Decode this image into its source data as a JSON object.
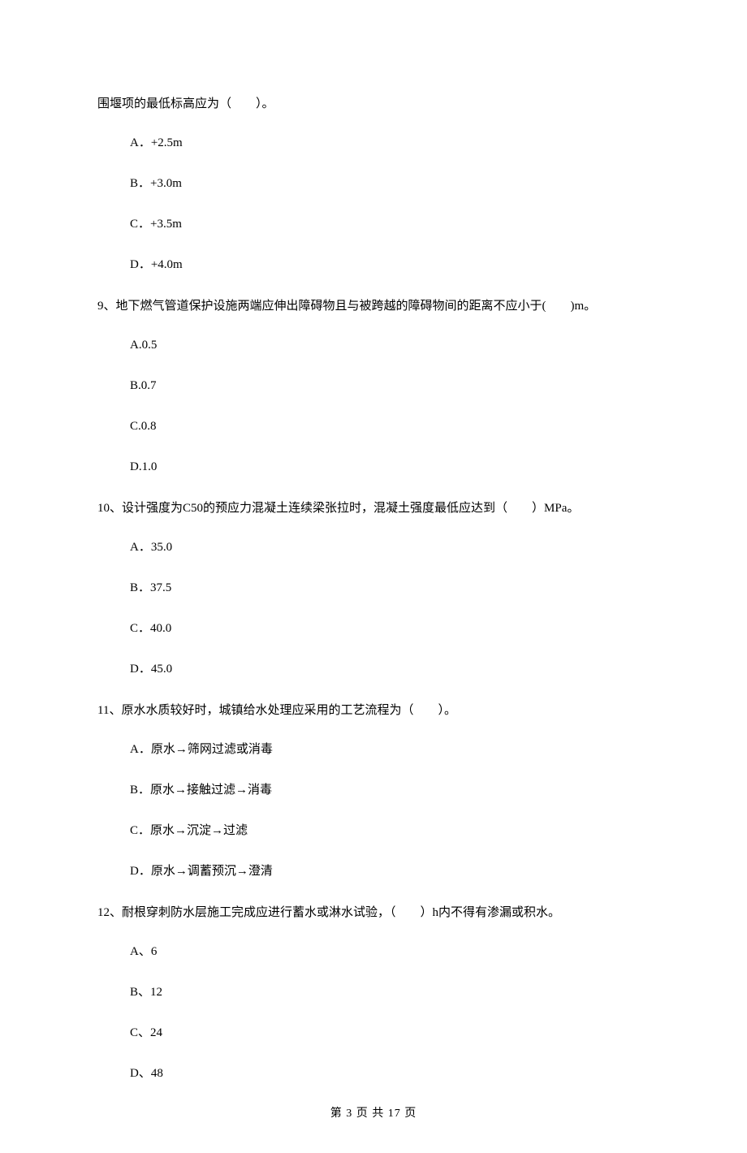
{
  "q8cont": {
    "text": "围堰项的最低标高应为（　　）。",
    "options": {
      "a": "A．+2.5m",
      "b": "B．+3.0m",
      "c": "C．+3.5m",
      "d": "D．+4.0m"
    }
  },
  "q9": {
    "text": "9、地下燃气管道保护设施两端应伸出障碍物且与被跨越的障碍物间的距离不应小于(　　)m。",
    "options": {
      "a": "A.0.5",
      "b": "B.0.7",
      "c": "C.0.8",
      "d": "D.1.0"
    }
  },
  "q10": {
    "text": "10、设计强度为C50的预应力混凝土连续梁张拉时，混凝土强度最低应达到（　　）MPa。",
    "options": {
      "a": "A．35.0",
      "b": "B．37.5",
      "c": "C．40.0",
      "d": "D．45.0"
    }
  },
  "q11": {
    "text": "11、原水水质较好时，城镇给水处理应采用的工艺流程为（　　）。",
    "options": {
      "a": "A．原水→筛网过滤或消毒",
      "b": "B．原水→接触过滤→消毒",
      "c": "C．原水→沉淀→过滤",
      "d": "D．原水→调蓄预沉→澄清"
    }
  },
  "q12": {
    "text": "12、耐根穿刺防水层施工完成应进行蓄水或淋水试验，（　　）h内不得有渗漏或积水。",
    "options": {
      "a": "A、6",
      "b": "B、12",
      "c": "C、24",
      "d": "D、48"
    }
  },
  "footer": "第 3 页 共 17 页"
}
